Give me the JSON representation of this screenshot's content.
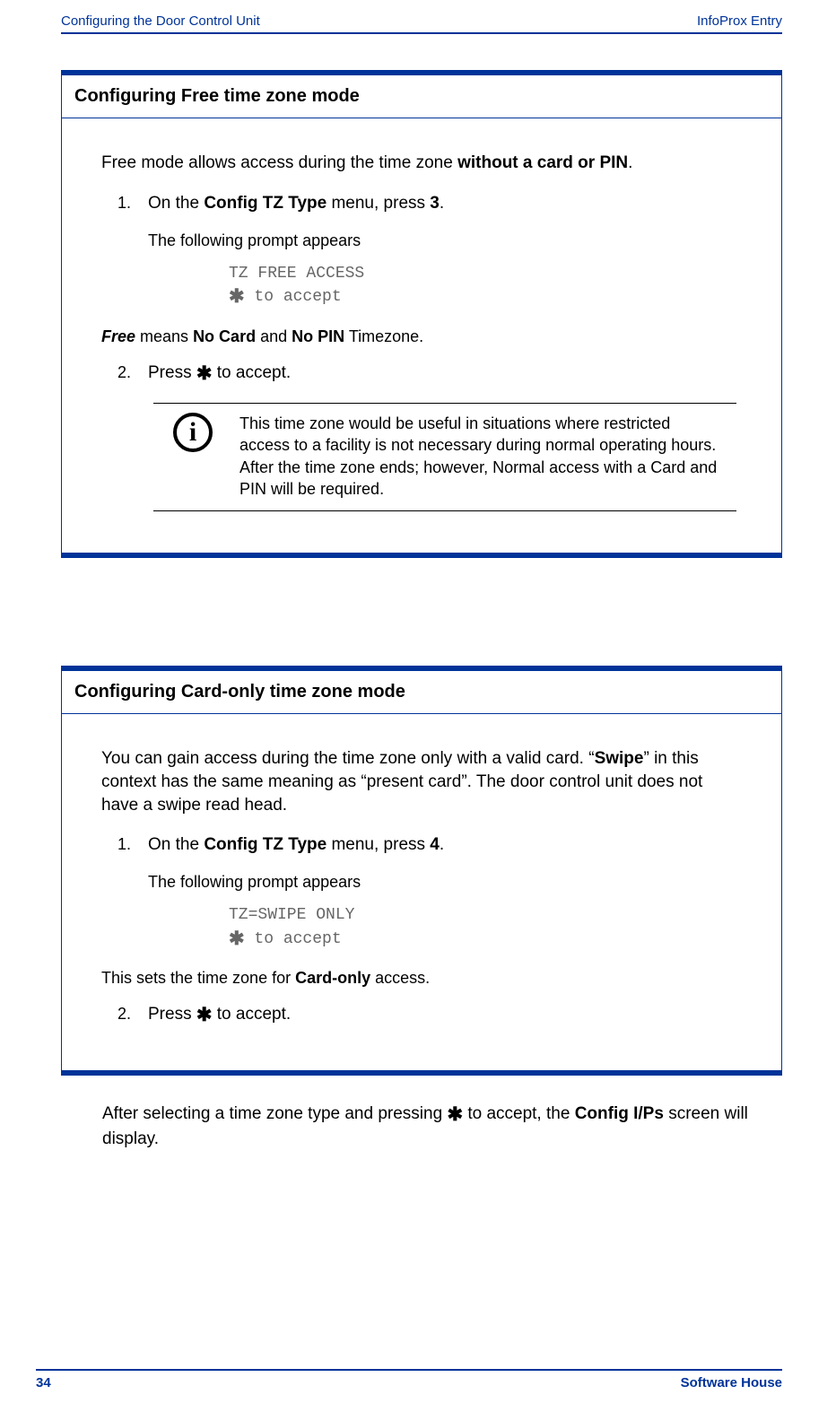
{
  "header": {
    "left": "Configuring the Door Control Unit",
    "right": "InfoProx Entry"
  },
  "section1": {
    "title": "Configuring Free time zone mode",
    "intro_pre": "Free mode allows access during the time zone ",
    "intro_bold": "without a card or PIN",
    "intro_post": ".",
    "step1_pre": "On the ",
    "step1_b1": "Config TZ Type",
    "step1_mid": " menu, press ",
    "step1_b2": "3",
    "step1_post": ".",
    "prompt_label": "The following prompt appears",
    "code_line1": "TZ FREE ACCESS",
    "code_line2_post": " to accept",
    "meaning_pre_i": "Free",
    "meaning_mid1": " means ",
    "meaning_b1": "No Card",
    "meaning_mid2": " and ",
    "meaning_b2": "No PIN",
    "meaning_post": " Timezone.",
    "step2_pre": "Press ",
    "step2_post": " to accept.",
    "info_glyph": "i",
    "note": "This time zone would be useful in situations where restricted access to a facility is not necessary during normal operating hours. After the time zone ends; however, Normal access with a Card and PIN will be required."
  },
  "section2": {
    "title": "Configuring Card-only time zone mode",
    "intro_pre": "You can gain access during the time zone only with a valid card. “",
    "intro_b1": "Swipe",
    "intro_post": "” in this context has the same meaning as “present card”. The door control unit does not have a swipe read head.",
    "step1_pre": "On the ",
    "step1_b1": "Config TZ Type",
    "step1_mid": " menu, press ",
    "step1_b2": "4",
    "step1_post": ".",
    "prompt_label": "The following prompt appears",
    "code_line1": "TZ=SWIPE ONLY",
    "code_line2_post": " to accept",
    "meaning_pre": "This sets the time zone for ",
    "meaning_b1": "Card-only",
    "meaning_post": " access.",
    "step2_pre": "Press ",
    "step2_post": " to accept."
  },
  "after": {
    "pre": "After selecting a time zone type and pressing ",
    "mid": " to accept, the ",
    "bold": "Config I/Ps",
    "post": " screen will display."
  },
  "footer": {
    "page": "34",
    "brand": "Software House"
  },
  "glyphs": {
    "asterisk": "✱"
  }
}
